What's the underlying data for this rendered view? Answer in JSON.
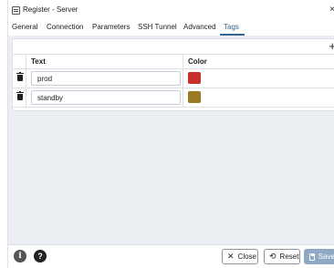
{
  "window": {
    "title": "Register - Server",
    "close_glyph": "×"
  },
  "tabs": [
    {
      "label": "General"
    },
    {
      "label": "Connection"
    },
    {
      "label": "Parameters"
    },
    {
      "label": "SSH Tunnel"
    },
    {
      "label": "Advanced"
    },
    {
      "label": "Tags",
      "active": true
    }
  ],
  "grid": {
    "add_glyph": "+",
    "columns": {
      "text": "Text",
      "color": "Color"
    },
    "rows": [
      {
        "text": "prod",
        "color": "#c9302c"
      },
      {
        "text": "standby",
        "color": "#9a7a25"
      }
    ]
  },
  "footer": {
    "info_glyph": "i",
    "help_glyph": "?",
    "close_label": "Close",
    "reset_label": "Reset",
    "save_label": "Save"
  },
  "colors": {
    "accent": "#326690",
    "panel_bg": "#ebeef3",
    "save_button": "#8fa8c4"
  }
}
